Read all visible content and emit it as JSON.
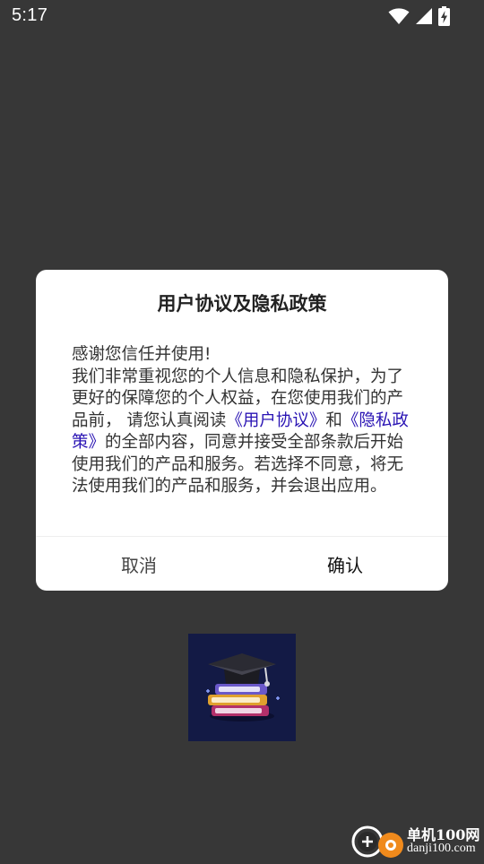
{
  "status_bar": {
    "time": "5:17",
    "icons": [
      "wifi-icon",
      "signal-icon",
      "battery-charging-icon"
    ]
  },
  "dialog": {
    "title": "用户协议及隐私政策",
    "body": {
      "part1": "感谢您信任并使用!\n我们非常重视您的个人信息和隐私保护，为了更好的保障您的个人权益，在您使用我们的产品前， 请您认真阅读",
      "link_user_agreement": "《用户协议》",
      "part2": "和",
      "link_privacy_policy": "《隐私政策》",
      "part3": "的全部内容，同意并接受全部条款后开始使用我们的产品和服务。若选择不同意，将无法使用我们的产品和服务，并会退出应用。"
    },
    "cancel_label": "取消",
    "confirm_label": "确认"
  },
  "watermark": {
    "brand": "单机100网",
    "domain": "danji100.com"
  },
  "colors": {
    "background": "#373737",
    "dialog": "#ffffff",
    "link": "#2a14b4",
    "logo_background": "#131a45"
  }
}
